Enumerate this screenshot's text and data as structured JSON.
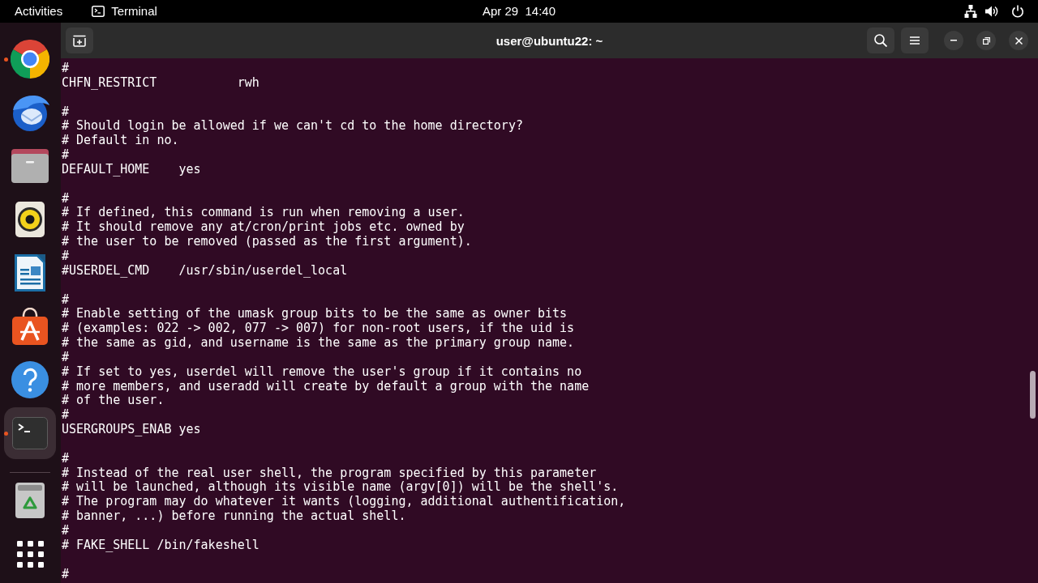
{
  "top_bar": {
    "activities": "Activities",
    "app_menu": "Terminal",
    "clock": "Apr 29  14:40"
  },
  "dock": {
    "apps": [
      {
        "kind": "browser",
        "running": true,
        "selected": false
      },
      {
        "kind": "mail",
        "running": false,
        "selected": false
      },
      {
        "kind": "files",
        "running": false,
        "selected": false
      },
      {
        "kind": "music",
        "running": false,
        "selected": false
      },
      {
        "kind": "writer",
        "running": false,
        "selected": false
      },
      {
        "kind": "store",
        "running": false,
        "selected": false
      },
      {
        "kind": "help",
        "running": false,
        "selected": false
      },
      {
        "kind": "terminal",
        "running": true,
        "selected": true
      }
    ],
    "utilities": [
      {
        "kind": "trash",
        "running": false,
        "selected": false
      }
    ]
  },
  "window": {
    "title": "user@ubuntu22: ~"
  },
  "terminal": {
    "blocks": [
      [
        "#",
        "CHFN_RESTRICT           rwh"
      ],
      [
        "#",
        "# Should login be allowed if we can't cd to the home directory?",
        "# Default in no.",
        "#",
        "DEFAULT_HOME    yes"
      ],
      [
        "#",
        "# If defined, this command is run when removing a user.",
        "# It should remove any at/cron/print jobs etc. owned by",
        "# the user to be removed (passed as the first argument).",
        "#",
        "#USERDEL_CMD    /usr/sbin/userdel_local"
      ],
      [
        "#",
        "# Enable setting of the umask group bits to be the same as owner bits",
        "# (examples: 022 -> 002, 077 -> 007) for non-root users, if the uid is",
        "# the same as gid, and username is the same as the primary group name.",
        "#",
        "# If set to yes, userdel will remove the user's group if it contains no",
        "# more members, and useradd will create by default a group with the name",
        "# of the user.",
        "#",
        "USERGROUPS_ENAB yes"
      ],
      [
        "#",
        "# Instead of the real user shell, the program specified by this parameter",
        "# will be launched, although its visible name (argv[0]) will be the shell's.",
        "# The program may do whatever it wants (logging, additional authentification,",
        "# banner, ...) before running the actual shell.",
        "#",
        "# FAKE_SHELL /bin/fakeshell"
      ],
      [
        "#"
      ]
    ]
  }
}
